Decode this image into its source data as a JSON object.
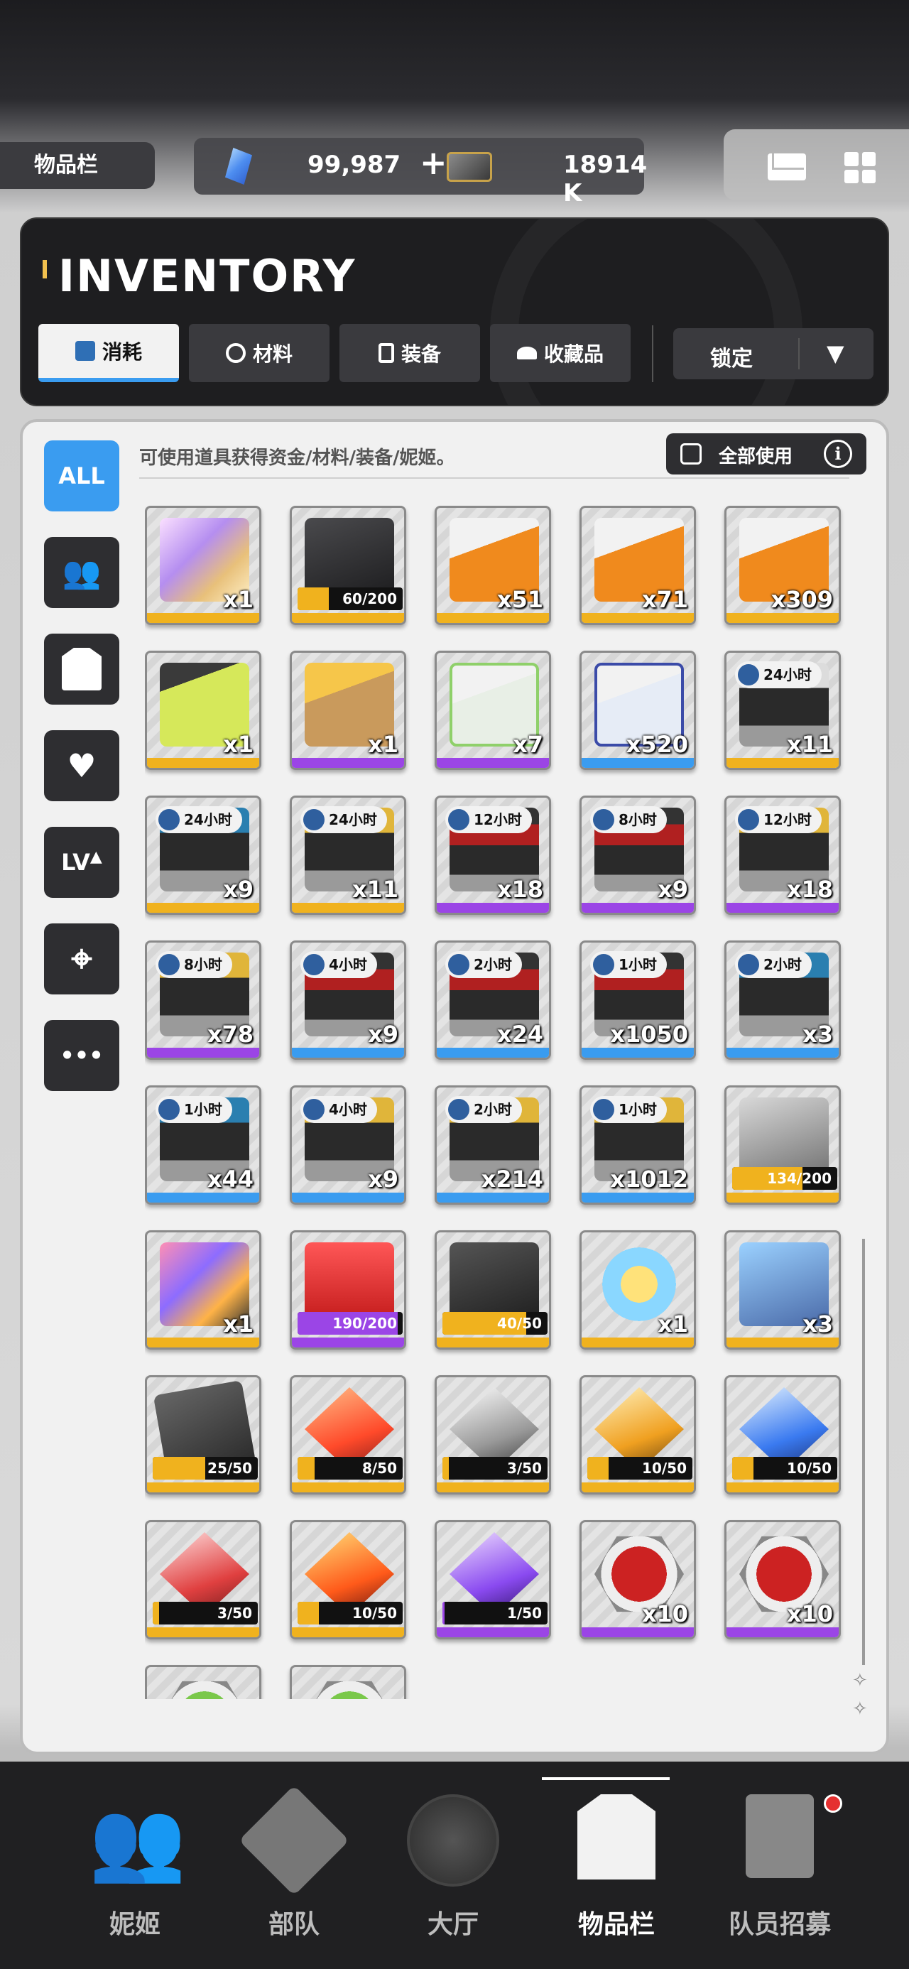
{
  "topbar": {
    "page_label": "物品栏",
    "gems": "99,987",
    "gems_plus": "+",
    "credits": "18914 K"
  },
  "header": {
    "title": "INVENTORY",
    "tabs": [
      {
        "label": "消耗",
        "icon": "consumable-icon",
        "active": true
      },
      {
        "label": "材料",
        "icon": "material-icon",
        "active": false
      },
      {
        "label": "装备",
        "icon": "equipment-icon",
        "active": false
      },
      {
        "label": "收藏品",
        "icon": "collectible-icon",
        "active": false
      }
    ],
    "lock_select": "锁定"
  },
  "filters": {
    "all_label": "ALL",
    "level_label": "LV",
    "more_label": "•••"
  },
  "hint": "可使用道具获得资金/材料/装备/妮姬。",
  "use_all_label": "全部使用",
  "info_label": "i",
  "items": [
    {
      "qty": "x1",
      "rarity": "gold",
      "art": "gift"
    },
    {
      "progress_text": "60/200",
      "progress": 0.3,
      "rarity": "gold",
      "art": "blackbox"
    },
    {
      "qty": "x51",
      "rarity": "gold",
      "art": "crate"
    },
    {
      "qty": "x71",
      "rarity": "gold",
      "art": "crate"
    },
    {
      "qty": "x309",
      "rarity": "gold",
      "art": "crate"
    },
    {
      "qty": "x1",
      "rarity": "gold",
      "art": "battery"
    },
    {
      "qty": "x1",
      "rarity": "purple",
      "art": "box"
    },
    {
      "qty": "x7",
      "rarity": "purple",
      "art": "crate-green"
    },
    {
      "qty": "x520",
      "rarity": "blue",
      "art": "crate-blue"
    },
    {
      "qty": "x11",
      "rarity": "gold",
      "art": "case",
      "timer": "24小时"
    },
    {
      "qty": "x9",
      "rarity": "gold",
      "art": "case-cyan",
      "timer": "24小时"
    },
    {
      "qty": "x11",
      "rarity": "gold",
      "art": "case-gold",
      "timer": "24小时"
    },
    {
      "qty": "x18",
      "rarity": "purple",
      "art": "case-red",
      "timer": "12小时"
    },
    {
      "qty": "x9",
      "rarity": "purple",
      "art": "case-red",
      "timer": "8小时"
    },
    {
      "qty": "x18",
      "rarity": "purple",
      "art": "case-gold",
      "timer": "12小时"
    },
    {
      "qty": "x78",
      "rarity": "purple",
      "art": "case-gold",
      "timer": "8小时"
    },
    {
      "qty": "x9",
      "rarity": "blue",
      "art": "case-red",
      "timer": "4小时"
    },
    {
      "qty": "x24",
      "rarity": "blue",
      "art": "case-red",
      "timer": "2小时"
    },
    {
      "qty": "x1050",
      "rarity": "blue",
      "art": "case-red",
      "timer": "1小时"
    },
    {
      "qty": "x3",
      "rarity": "blue",
      "art": "case-cyan",
      "timer": "2小时"
    },
    {
      "qty": "x44",
      "rarity": "blue",
      "art": "case-cyan",
      "timer": "1小时"
    },
    {
      "qty": "x9",
      "rarity": "blue",
      "art": "case-gold",
      "timer": "4小时"
    },
    {
      "qty": "x214",
      "rarity": "blue",
      "art": "case-gold",
      "timer": "2小时"
    },
    {
      "qty": "x1012",
      "rarity": "blue",
      "art": "case-gold",
      "timer": "1小时"
    },
    {
      "progress_text": "134/200",
      "progress": 0.67,
      "rarity": "gold",
      "art": "grey"
    },
    {
      "qty": "x1",
      "rarity": "gold",
      "art": "colorbox"
    },
    {
      "progress_text": "190/200",
      "progress": 0.95,
      "rarity": "purple",
      "art": "redbox",
      "bar_color": "#9b45e6"
    },
    {
      "progress_text": "40/50",
      "progress": 0.8,
      "rarity": "gold",
      "art": "dark"
    },
    {
      "qty": "x1",
      "rarity": "gold",
      "art": "star"
    },
    {
      "qty": "x3",
      "rarity": "gold",
      "art": "robot"
    },
    {
      "progress_text": "25/50",
      "progress": 0.5,
      "rarity": "gold",
      "art": "card-dark"
    },
    {
      "progress_text": "8/50",
      "progress": 0.16,
      "rarity": "gold",
      "art": "ssr"
    },
    {
      "progress_text": "3/50",
      "progress": 0.06,
      "rarity": "gold",
      "art": "r-silver"
    },
    {
      "progress_text": "10/50",
      "progress": 0.2,
      "rarity": "gold",
      "art": "r-gold"
    },
    {
      "progress_text": "10/50",
      "progress": 0.2,
      "rarity": "gold",
      "art": "r-blue"
    },
    {
      "progress_text": "3/50",
      "progress": 0.06,
      "rarity": "gold",
      "art": "r-red"
    },
    {
      "progress_text": "10/50",
      "progress": 0.2,
      "rarity": "gold",
      "art": "r-fire"
    },
    {
      "progress_text": "1/50",
      "progress": 0.02,
      "rarity": "purple",
      "art": "r-purple",
      "bar_color": "#9b45e6"
    },
    {
      "qty": "x10",
      "rarity": "purple",
      "art": "hex-red"
    },
    {
      "qty": "x10",
      "rarity": "purple",
      "art": "hex-red"
    },
    {
      "rarity": "gold",
      "art": "hex-green"
    },
    {
      "rarity": "gold",
      "art": "hex-green"
    }
  ],
  "bottom_nav": [
    {
      "label": "妮姬",
      "icon": "nikke-icon",
      "active": false
    },
    {
      "label": "部队",
      "icon": "squad-icon",
      "active": false
    },
    {
      "label": "大厅",
      "icon": "lobby-icon",
      "active": false
    },
    {
      "label": "物品栏",
      "icon": "inventory-icon",
      "active": true
    },
    {
      "label": "队员招募",
      "icon": "recruit-icon",
      "active": false,
      "badge": true
    }
  ],
  "colors": {
    "accent_blue": "#3a9cf0",
    "gold": "#f0b21e",
    "purple": "#9b45e6",
    "notification_red": "#e53030"
  }
}
